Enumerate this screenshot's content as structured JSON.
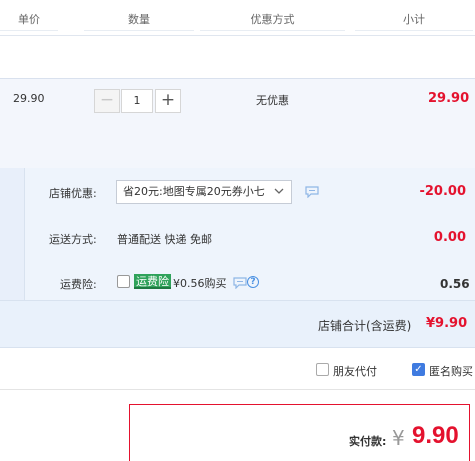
{
  "header": {
    "columns": [
      "单价",
      "数量",
      "优惠方式",
      "小计"
    ]
  },
  "product": {
    "price": "29.90",
    "quantity": "1",
    "minus_symbol": "−",
    "plus_symbol": "+",
    "promotion": "无优惠",
    "subtotal": "29.90"
  },
  "shop": {
    "discount_label": "店铺优惠:",
    "discount_select": "省20元:地图专属20元券小七",
    "discount_amount": "-20.00",
    "shipping_label": "运送方式:",
    "shipping_value": "普通配送 快递 免邮",
    "shipping_amount": "0.00",
    "insurance_label": "运费险:",
    "insurance_badge": "运费险",
    "insurance_text": "¥0.56购买",
    "insurance_help": "?",
    "insurance_amount": "0.56",
    "total_label": "店铺合计(含运费)",
    "total_amount": "¥9.90"
  },
  "options": {
    "friend_pay_label": "朋友代付",
    "friend_pay_checked": false,
    "anonymous_label": "匿名购买",
    "anonymous_checked": true
  },
  "payment": {
    "label": "实付款:",
    "currency": "¥",
    "amount": "9.90"
  },
  "colors": {
    "accent_red": "#e4122e",
    "section_bg": "#eef4fc",
    "checkbox_blue": "#3f7be0",
    "badge_green": "#2fa25b"
  }
}
